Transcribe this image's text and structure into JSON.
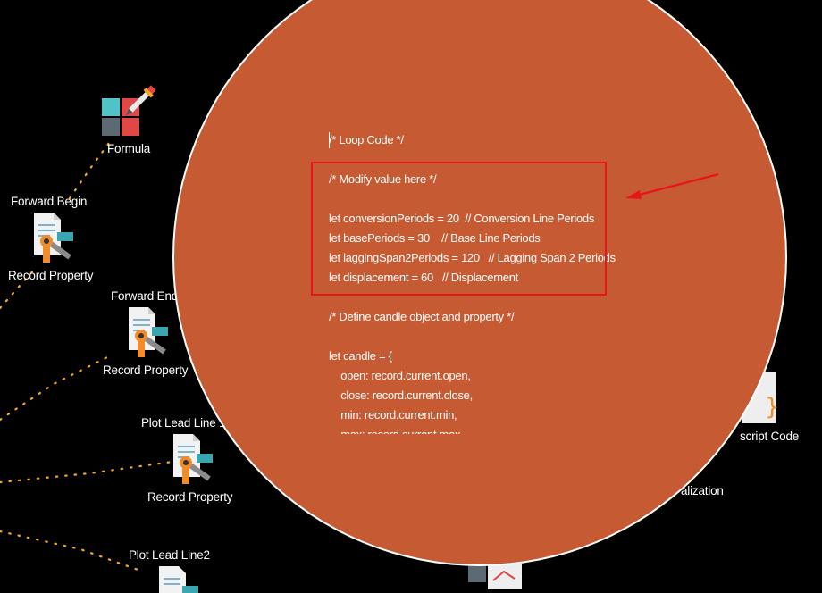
{
  "nodes": {
    "formula": {
      "label": "Formula"
    },
    "forward_begin": {
      "label": "Forward Begin"
    },
    "record_property_1": {
      "label": "Record Property"
    },
    "forward_end": {
      "label": "Forward End"
    },
    "record_property_2": {
      "label": "Record Property"
    },
    "plot_lead_line_1": {
      "label": "Plot Lead Line 1"
    },
    "record_property_3": {
      "label": "Record Property"
    },
    "plot_lead_line_2": {
      "label": "Plot Lead Line2"
    },
    "script_code": {
      "label": "script Code"
    },
    "visualization": {
      "label": "alization"
    }
  },
  "code_editor": {
    "lines": [
      "/* Loop Code */",
      "",
      "/* Modify value here */",
      "",
      "let conversionPeriods = 20  // Conversion Line Periods",
      "let basePeriods = 30    // Base Line Periods",
      "let laggingSpan2Periods = 120   // Lagging Span 2 Periods",
      "let displacement = 60   // Displacement",
      "",
      "/* Define candle object and property */",
      "",
      "let candle = {",
      "    open: record.current.open,",
      "    close: record.current.close,",
      "    min: record.current.min,",
      "    max: record.current.max,"
    ]
  },
  "colors": {
    "bubble": "#c65b33",
    "highlight": "#e8141c",
    "connector": "#f5a623"
  }
}
